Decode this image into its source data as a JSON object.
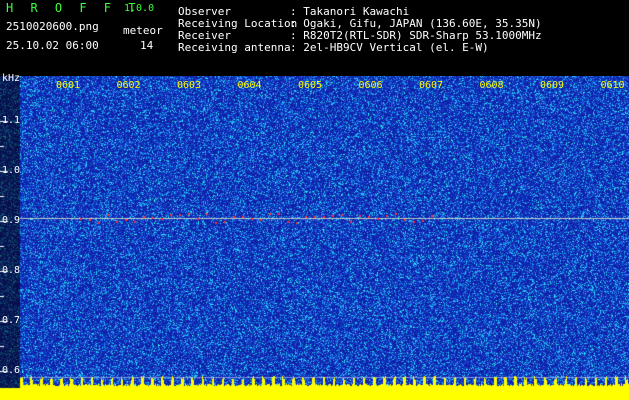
{
  "header": {
    "app_title": "H R O F F T",
    "version": "1.0.0",
    "filename": "2510020600.png",
    "datetime": "25.10.02 06:00",
    "meteor_label": "meteor",
    "meteor_count": "14",
    "info": [
      {
        "label": "Observer",
        "value": ": Takanori Kawachi"
      },
      {
        "label": "Receiving Location",
        "value": ": Ogaki, Gifu, JAPAN (136.60E, 35.35N)"
      },
      {
        "label": "Receiver",
        "value": ": R820T2(RTL-SDR) SDR-Sharp 53.1000MHz"
      },
      {
        "label": "Receiving antenna",
        "value": ": 2el-HB9CV Vertical (el. E-W)"
      }
    ]
  },
  "chart_data": {
    "type": "heatmap",
    "ylabel": "kHz",
    "y_ticks": [
      "1.1",
      "1.0",
      "0.9",
      "0.8",
      "0.7",
      "0.6"
    ],
    "x_ticks": [
      "0601",
      "0602",
      "0603",
      "0604",
      "0605",
      "0606",
      "0607",
      "0608",
      "0609",
      "0610"
    ],
    "ylim": [
      0.57,
      1.17
    ],
    "carrier_khz": 0.905,
    "colors": {
      "background": "#1020a8",
      "noise": "#20c8ff",
      "signal": "#ff3030",
      "baseline": "#ffff00"
    }
  }
}
